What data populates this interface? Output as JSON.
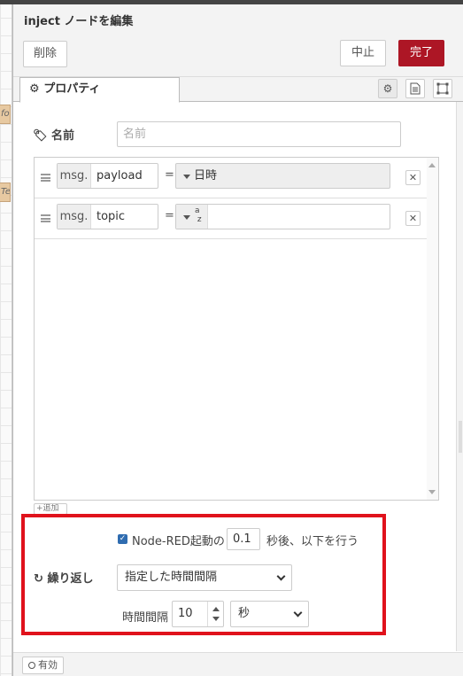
{
  "background": {
    "node1_text": "foo",
    "node2_text": "Test"
  },
  "tray": {
    "title": "inject ノードを編集",
    "delete_label": "削除",
    "cancel_label": "中止",
    "done_label": "完了",
    "accent_color": "#ad1625"
  },
  "tabs": {
    "properties_label": "プロパティ",
    "icons": [
      "gear-icon",
      "description-icon",
      "appearance-icon"
    ]
  },
  "form": {
    "name_label": "名前",
    "name_placeholder": "名前",
    "name_value": "",
    "props": [
      {
        "prefix": "msg.",
        "key": "payload",
        "type_label": "日時",
        "type_icon": ""
      },
      {
        "prefix": "msg.",
        "key": "topic",
        "type_label": "",
        "type_icon": "az"
      }
    ],
    "add_label": "追加"
  },
  "schedule": {
    "once_checked": true,
    "once_label": "Node-RED起動の",
    "once_delay": "0.1",
    "once_after_label": "秒後、以下を行う",
    "repeat_label": "繰り返し",
    "repeat_option": "指定した時間間隔",
    "interval_label": "時間間隔",
    "interval_value": "10",
    "interval_unit": "秒",
    "highlight_color": "#e0121c"
  },
  "footer": {
    "enable_label": "有効"
  }
}
